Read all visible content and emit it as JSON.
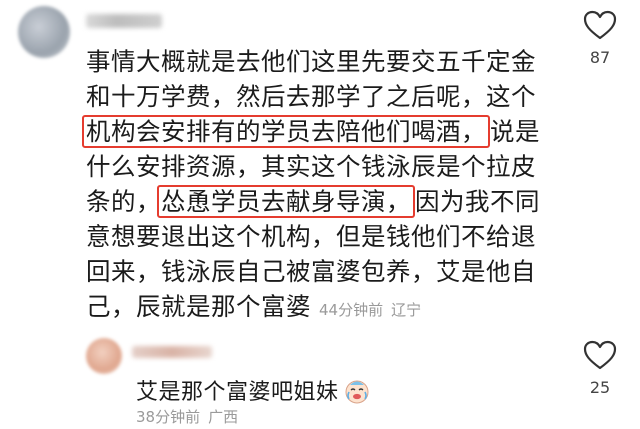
{
  "comment": {
    "lines_before": [
      "事情大概就是去他们这里先要交五千定金",
      "和十万学费，然后去那学了之后呢，这个"
    ],
    "highlight_1": "机构会安排有的学员去陪他们喝酒，",
    "after_highlight_1": "说是",
    "line_5": "什么安排资源，其实这个钱泳辰是个拉皮",
    "before_highlight_2": "条的，",
    "highlight_2": "怂恿学员去献身导演，",
    "after_highlight_2": "因为我不同",
    "lines_after": [
      "意想要退出这个机构，但是钱他们不给退",
      "回来，钱泳辰自己被富婆包养，艾是他自"
    ],
    "last_line": "己，辰就是那个富婆",
    "time": "44分钟前",
    "location": "辽宁",
    "like_count": "87"
  },
  "reply": {
    "text": "艾是那个富婆吧姐妹",
    "emoji": "crying-laughing-baby-emoji",
    "time": "38分钟前",
    "location": "广西",
    "like_count": "25"
  },
  "colors": {
    "highlight_border": "#e53c2f",
    "meta_text": "#9a9a9a"
  }
}
